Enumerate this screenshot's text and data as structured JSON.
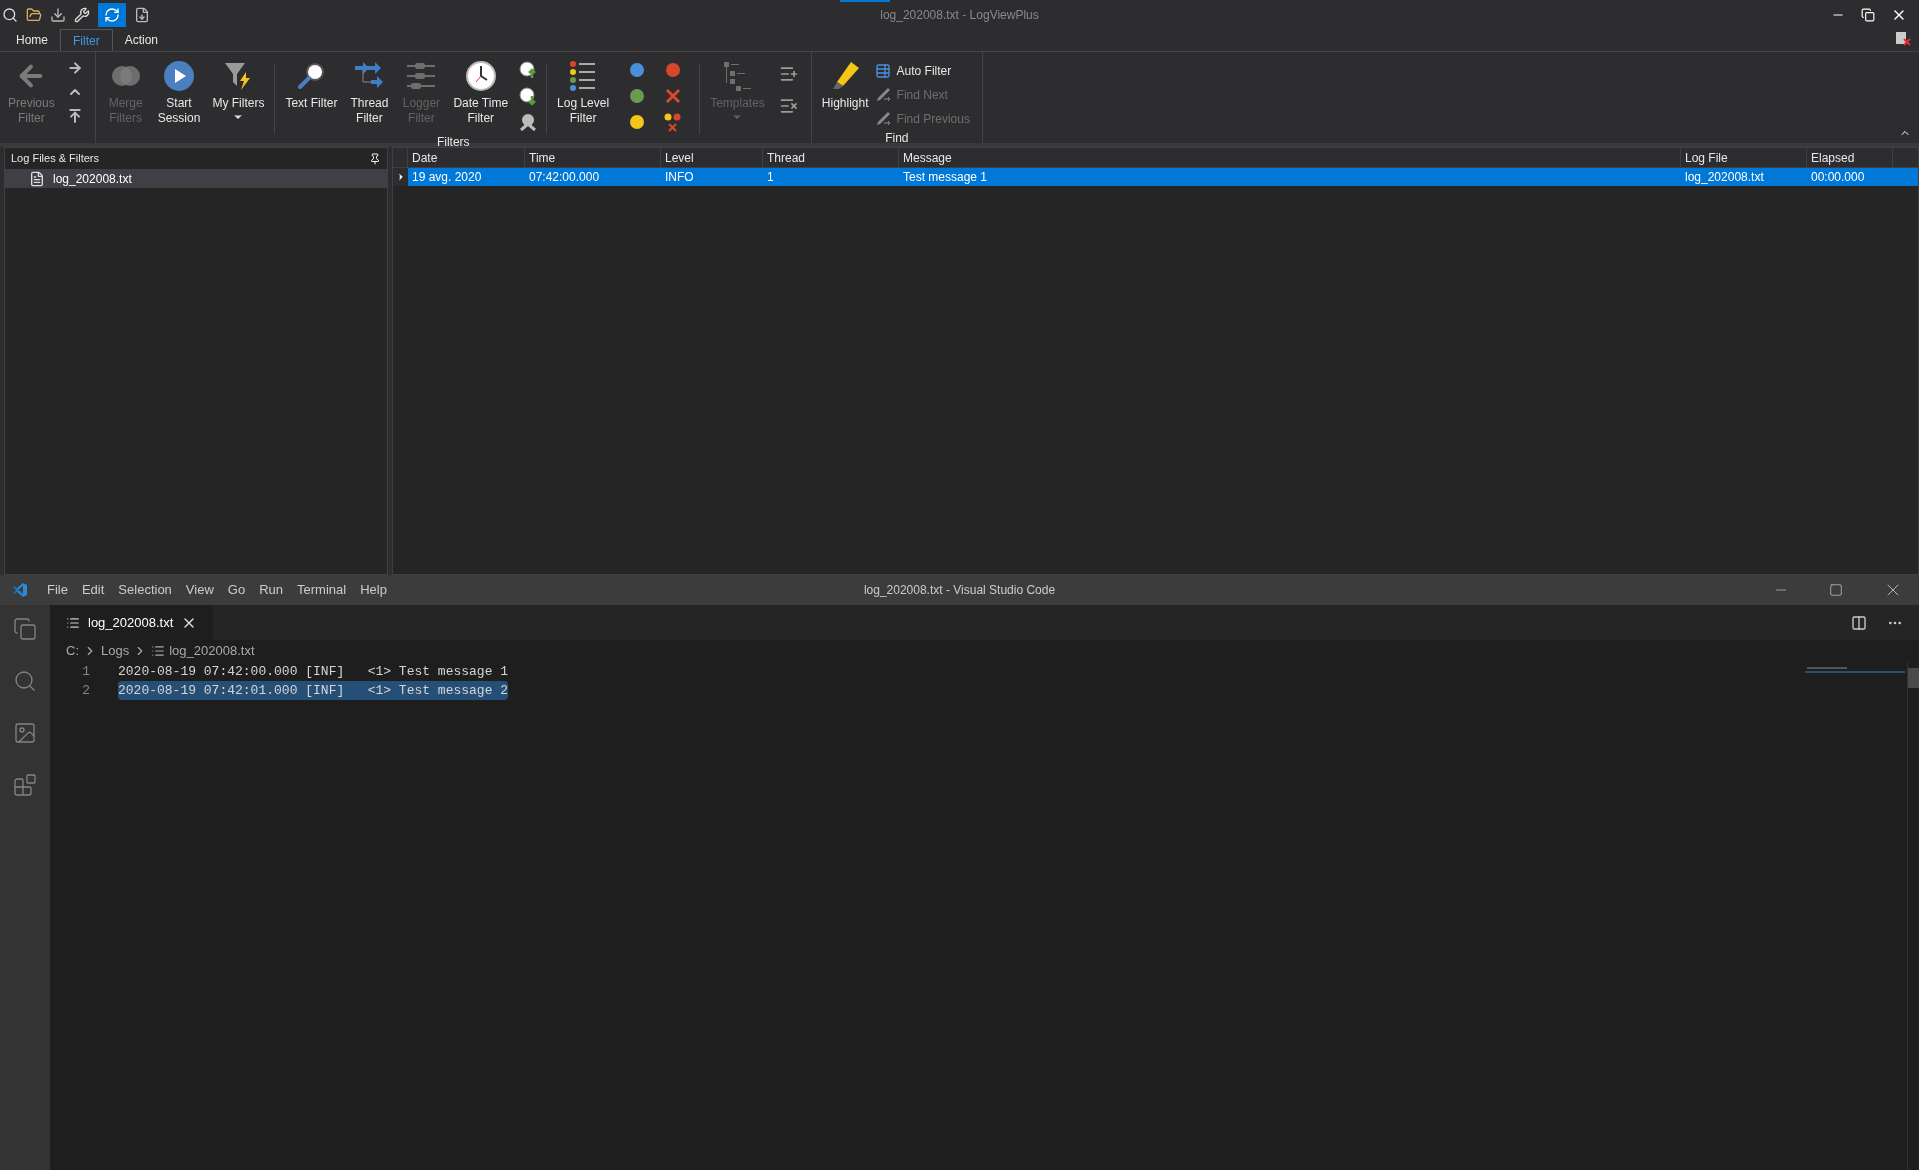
{
  "logviewplus": {
    "title": "log_202008.txt - LogViewPlus",
    "tabs": [
      {
        "label": "Home",
        "selected": false
      },
      {
        "label": "Filter",
        "selected": true
      },
      {
        "label": "Action",
        "selected": false
      }
    ],
    "ribbon": {
      "navigation": {
        "label": "Previous\nFilter",
        "disabled": true
      },
      "groups": [
        {
          "label": "Filters",
          "buttons": [
            {
              "kind": "large",
              "label": "Merge\nFilters",
              "disabled": true
            },
            {
              "kind": "large",
              "label": "Start\nSession",
              "disabled": false
            },
            {
              "kind": "dropdown",
              "label": "My Filters",
              "disabled": false
            },
            {
              "kind": "separator"
            },
            {
              "kind": "large",
              "label": "Text Filter",
              "disabled": false
            },
            {
              "kind": "large",
              "label": "Thread\nFilter",
              "disabled": false
            },
            {
              "kind": "large",
              "label": "Logger\nFilter",
              "disabled": true
            },
            {
              "kind": "large",
              "label": "Date Time\nFilter",
              "disabled": false
            },
            {
              "kind": "icons"
            },
            {
              "kind": "separator"
            },
            {
              "kind": "large",
              "label": "Log Level\nFilter",
              "disabled": false
            },
            {
              "kind": "dots"
            },
            {
              "kind": "separator"
            },
            {
              "kind": "dropdown",
              "label": "Templates",
              "disabled": true
            },
            {
              "kind": "icons"
            }
          ]
        },
        {
          "label": "Find",
          "buttons": [
            {
              "kind": "large",
              "label": "Highlight",
              "disabled": false
            },
            {
              "kind": "list",
              "items": [
                {
                  "label": "Auto Filter",
                  "disabled": false
                },
                {
                  "label": "Find Next",
                  "disabled": true
                },
                {
                  "label": "Find Previous",
                  "disabled": true
                }
              ]
            }
          ]
        }
      ]
    },
    "panel": {
      "title": "Log Files & Filters",
      "items": [
        {
          "label": "log_202008.txt",
          "selected": true
        }
      ]
    },
    "grid": {
      "columns": [
        "Date",
        "Time",
        "Level",
        "Thread",
        "Message",
        "Log File",
        "Elapsed"
      ],
      "rows": [
        {
          "selected": true,
          "cells": [
            "19 avg. 2020",
            "07:42:00.000",
            "INFO",
            "1",
            "Test message 1",
            "log_202008.txt",
            "00:00.000"
          ]
        }
      ]
    }
  },
  "vscode": {
    "title": "log_202008.txt - Visual Studio Code",
    "menu": [
      "File",
      "Edit",
      "Selection",
      "View",
      "Go",
      "Run",
      "Terminal",
      "Help"
    ],
    "tabs": [
      {
        "label": "log_202008.txt",
        "selected": true
      }
    ],
    "breadcrumbs": [
      "C:",
      "Logs",
      "log_202008.txt"
    ],
    "lines": [
      {
        "number": "1",
        "text": "2020-08-19 07:42:00.000 [INF]   <1> Test message 1",
        "selected": false
      },
      {
        "number": "2",
        "text": "2020-08-19 07:42:01.000 [INF]   <1> Test message 2",
        "selected": true
      }
    ]
  }
}
